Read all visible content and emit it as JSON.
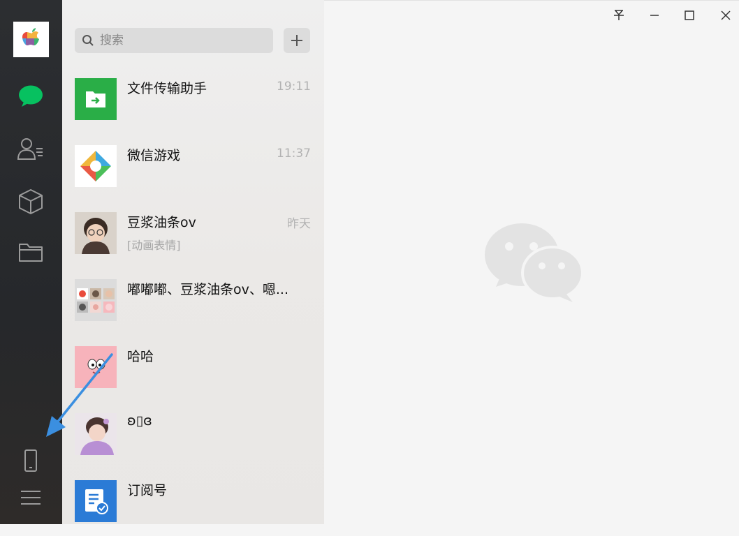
{
  "sidebar": {
    "avatar_icon": "apple-logo-avatar",
    "nav": [
      "chat-bubble-icon",
      "contacts-icon",
      "cube-icon",
      "folder-icon",
      "phone-icon",
      "menu-icon"
    ],
    "accent": "#07c160"
  },
  "search": {
    "placeholder": "搜索"
  },
  "add_button": {
    "icon": "plus-icon"
  },
  "chats": [
    {
      "name": "文件传输助手",
      "time": "19:11",
      "preview": ""
    },
    {
      "name": "微信游戏",
      "time": "11:37",
      "preview": ""
    },
    {
      "name": "豆浆油条ov",
      "time": "昨天",
      "preview": "[动画表情]"
    },
    {
      "name": "嘟嘟嘟、豆浆油条ov、嗯...",
      "time": "",
      "preview": ""
    },
    {
      "name": "哈哈",
      "time": "",
      "preview": ""
    },
    {
      "name": "ʚ▯ɞ",
      "time": "",
      "preview": ""
    },
    {
      "name": "订阅号",
      "time": "",
      "preview": ""
    }
  ],
  "window_controls": [
    "pin-icon",
    "minimize-icon",
    "maximize-icon",
    "close-icon"
  ],
  "main": {
    "logo_icon": "wechat-logo-watermark"
  },
  "annotation": {
    "arrow_color": "#3b8fe0"
  }
}
